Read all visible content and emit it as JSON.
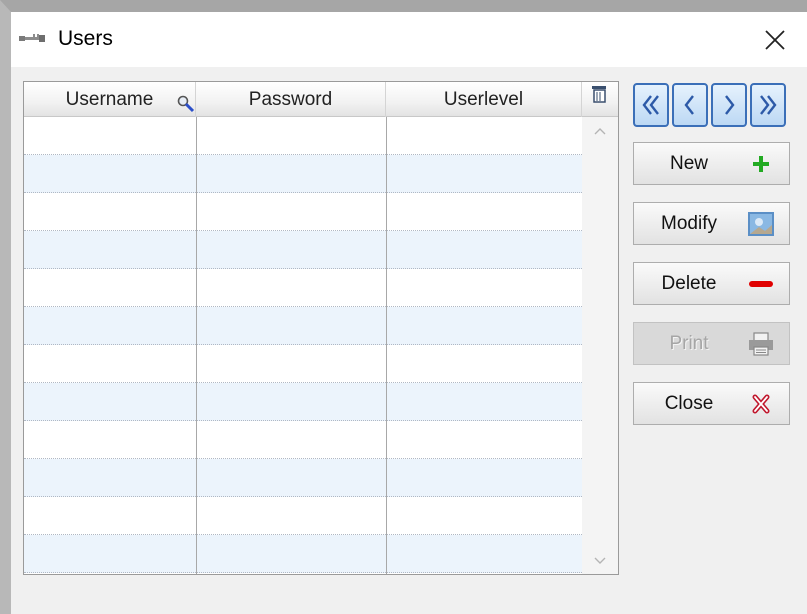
{
  "window": {
    "title": "Users"
  },
  "grid": {
    "columns": [
      "Username",
      "Password",
      "Userlevel"
    ],
    "rows": [
      [
        "",
        "",
        ""
      ],
      [
        "",
        "",
        ""
      ],
      [
        "",
        "",
        ""
      ],
      [
        "",
        "",
        ""
      ],
      [
        "",
        "",
        ""
      ],
      [
        "",
        "",
        ""
      ],
      [
        "",
        "",
        ""
      ],
      [
        "",
        "",
        ""
      ],
      [
        "",
        "",
        ""
      ],
      [
        "",
        "",
        ""
      ],
      [
        "",
        "",
        ""
      ],
      [
        "",
        "",
        ""
      ]
    ],
    "alt_row_color": "#ecf4fc"
  },
  "navigation": {
    "icons": [
      "first-record-icon",
      "previous-record-icon",
      "next-record-icon",
      "last-record-icon"
    ]
  },
  "actions": {
    "new": {
      "label": "New",
      "icon": "plus-icon",
      "color": "#22aa22"
    },
    "modify": {
      "label": "Modify",
      "icon": "picture-icon"
    },
    "delete": {
      "label": "Delete",
      "icon": "minus-icon",
      "color": "#e00000"
    },
    "print": {
      "label": "Print",
      "icon": "printer-icon",
      "disabled": true
    },
    "close": {
      "label": "Close",
      "icon": "close-cross-icon",
      "color": "#c0162c"
    }
  },
  "colors": {
    "accent": "#3b6fb8",
    "window_bg": "#f0f0f0"
  }
}
